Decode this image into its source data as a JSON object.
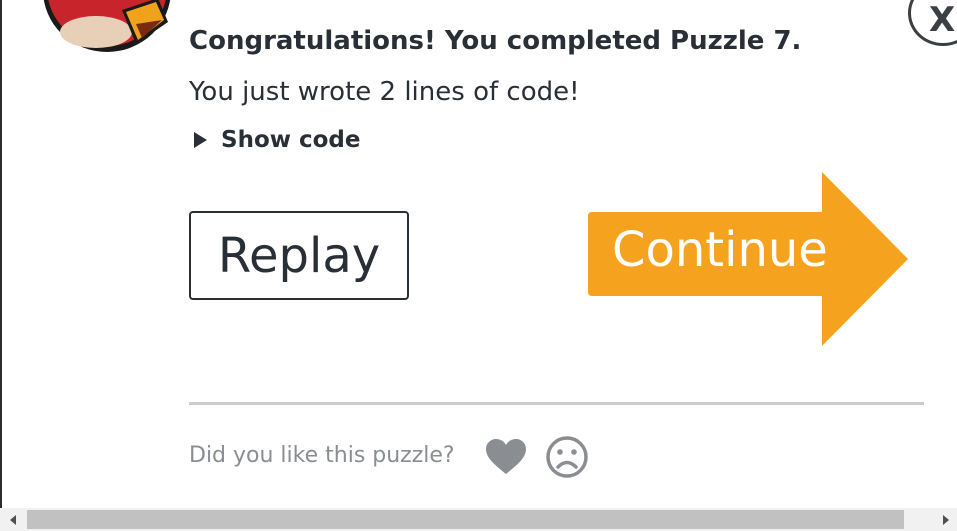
{
  "dialog": {
    "title": "Congratulations! You completed Puzzle 7.",
    "subtitle": "You just wrote 2 lines of code!",
    "show_code_label": "Show code",
    "close_label": "X"
  },
  "actions": {
    "replay_label": "Replay",
    "continue_label": "Continue"
  },
  "feedback": {
    "prompt": "Did you like this puzzle?",
    "like_icon": "heart-icon",
    "dislike_icon": "sad-face-icon"
  },
  "colors": {
    "accent_orange": "#f5a31e",
    "text_dark": "#292f36",
    "text_muted": "#8a8e92",
    "icon_gray": "#8a8e92",
    "avatar_red": "#c8242c"
  }
}
